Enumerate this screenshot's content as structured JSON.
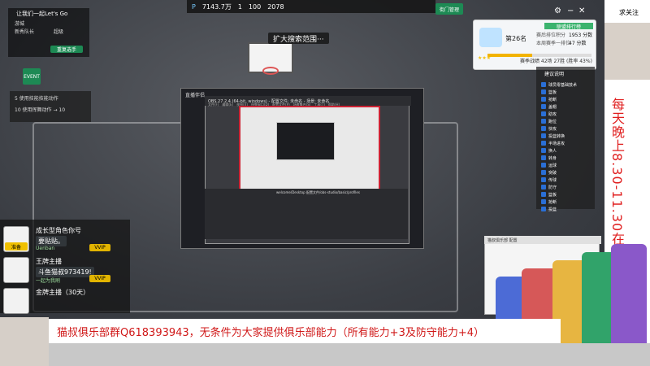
{
  "top_left": {
    "greeting": "让我们一起Let's Go",
    "labels": [
      "游城",
      "新秀队长",
      "超级"
    ],
    "buttons": [
      "重复选手"
    ]
  },
  "top_bar": {
    "stat1": "P",
    "value1": "7143.7万",
    "value2": "1",
    "value3": "100",
    "value4": "2078",
    "right_btn": "街门管理"
  },
  "scene": {
    "title_bubble": "扩大搜索范围···"
  },
  "event_button": {
    "label": "EVENT"
  },
  "left_menu": {
    "lines": [
      "5 使用技能技能动作",
      "10 使用挥舞动作 → 10"
    ]
  },
  "rank_card": {
    "header": "联盟排行榜",
    "rank_label": "第26名",
    "progress_percent": 43,
    "footer": "赛季战绩 42场 27胜 (胜率 43%)",
    "stats": [
      {
        "label": "赛后排位积分",
        "value": "1953 分数"
      },
      {
        "label": "本周赛季一排位",
        "value": "47 分数"
      }
    ]
  },
  "event_list": {
    "title": "建议说明",
    "items": [
      "球员零基础技术",
      "篮板",
      "抢断",
      "盖帽",
      "助攻",
      "跑位",
      "快攻",
      "投篮转换",
      "半场进攻",
      "换人",
      "转身",
      "运球",
      "突破",
      "传球",
      "防守",
      "篮板",
      "抢断",
      "投篮"
    ]
  },
  "popup": {
    "title_left": "直播伴侣",
    "inner_title": "OBS 27.2.4 (64-bit, windows) - 配置文件: 未命名 - 场景: 未命名",
    "menu": [
      "文件(F)",
      "编辑(E)",
      "视图(V)",
      "停靠窗口(D)",
      "配置文件(P)",
      "场景集合(S)",
      "工具(T)",
      "帮助(H)"
    ],
    "bottom_path": "welcome/Desktop 配置文件/obs-studio/basic/profiles"
  },
  "chat": {
    "items": [
      {
        "name": "成长型角色你号",
        "msg": "要贴贴。",
        "footer": "Uenban",
        "vip": "VVIP"
      },
      {
        "name": "王牌主播",
        "msg": "斗鱼猫叔973419!",
        "footer": "一起为我刷",
        "vip": "VVIP"
      },
      {
        "name": "金牌主播（30天）",
        "msg": "",
        "footer": "",
        "vip": ""
      }
    ],
    "badge_left": "准备"
  },
  "right_panel": {
    "top_text": "求关注",
    "vertical_text": "每天晚上8.30-11.30在线直播！！"
  },
  "banner": {
    "text": "猫叔俱乐部群Q618393943，无条件为大家提供俱乐部能力（所有能力+3及防守能力+4）"
  },
  "bottom_window": {
    "title": "猫叔俱乐部 配置"
  },
  "colors": {
    "accent_red": "#d01818",
    "green": "#1d8a54",
    "gold": "#e2b400"
  }
}
